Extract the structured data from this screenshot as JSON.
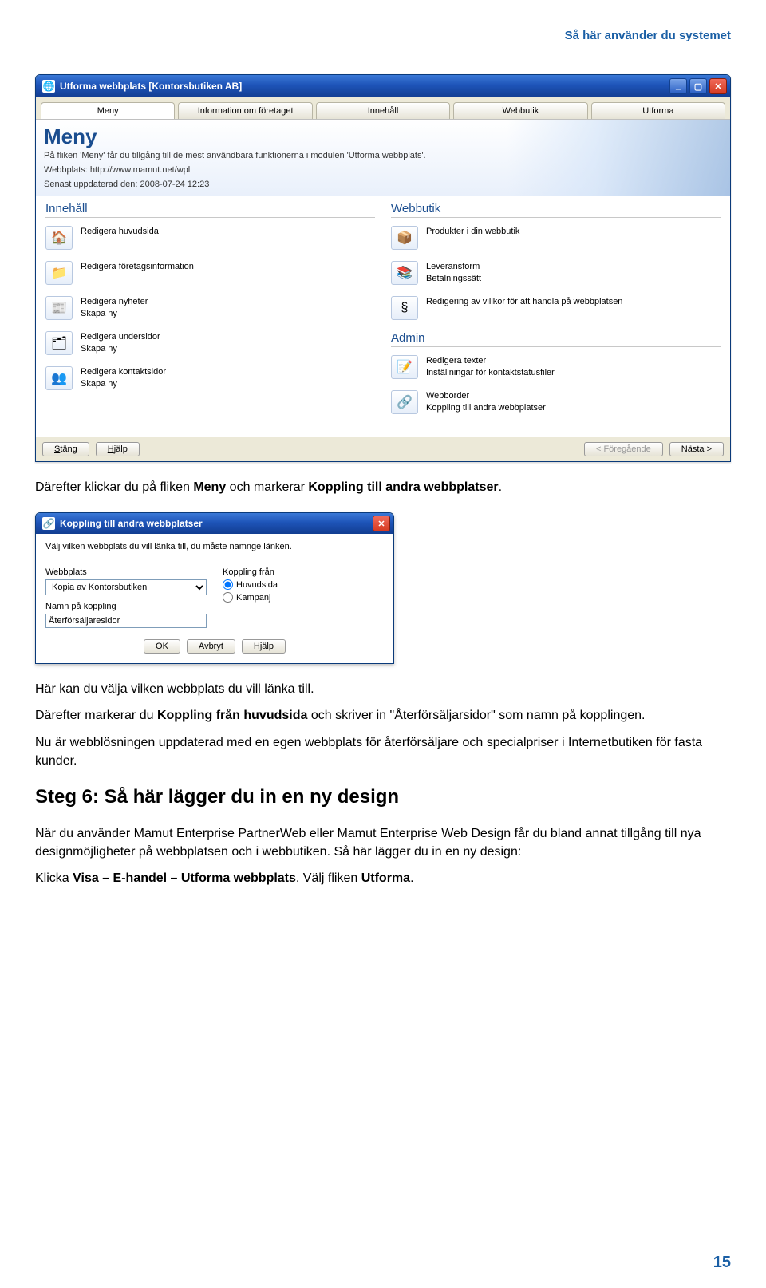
{
  "headerRight": "Så här använder du systemet",
  "pageNumber": "15",
  "window1": {
    "title": "Utforma webbplats [Kontorsbutiken AB]",
    "tabs": [
      "Meny",
      "Information om företaget",
      "Innehåll",
      "Webbutik",
      "Utforma"
    ],
    "activeTab": 0,
    "pageTitle": "Meny",
    "pageSub": "På fliken 'Meny' får du tillgång till de mest användbara funktionerna i modulen 'Utforma webbplats'.",
    "metaUrlLabel": "Webbplats: http://www.mamut.net/wpl",
    "metaUpdatedLabel": "Senast uppdaterad den: 2008-07-24 12:23",
    "colInnehall": {
      "title": "Innehåll",
      "items": [
        {
          "icon": "🏠",
          "lines": [
            "Redigera huvudsida"
          ]
        },
        {
          "icon": "📁",
          "lines": [
            "Redigera företagsinformation"
          ]
        },
        {
          "icon": "📰",
          "lines": [
            "Redigera nyheter",
            "Skapa ny"
          ]
        },
        {
          "icon": "🗂",
          "lines": [
            "Redigera undersidor",
            "Skapa ny"
          ]
        },
        {
          "icon": "👥",
          "lines": [
            "Redigera kontaktsidor",
            "Skapa ny"
          ]
        }
      ]
    },
    "colWebbutik": {
      "title": "Webbutik",
      "items": [
        {
          "icon": "📦",
          "lines": [
            "Produkter i din webbutik"
          ]
        },
        {
          "icon": "📚",
          "lines": [
            "Leveransform",
            "Betalningssätt"
          ]
        },
        {
          "icon": "§",
          "lines": [
            "Redigering av villkor för att handla på webbplatsen"
          ]
        }
      ]
    },
    "colAdmin": {
      "title": "Admin",
      "items": [
        {
          "icon": "📝",
          "lines": [
            "Redigera texter",
            "Inställningar för kontaktstatusfiler"
          ]
        },
        {
          "icon": "🔗",
          "lines": [
            "Webborder",
            "Koppling till andra webbplatser"
          ]
        }
      ]
    },
    "footerButtons": {
      "close": "Stäng",
      "help": "Hjälp",
      "prev": "< Föregående",
      "next": "Nästa >"
    }
  },
  "para1_pre": "Därefter klickar du på fliken ",
  "para1_b1": "Meny",
  "para1_mid": " och markerar ",
  "para1_b2": "Koppling till andra webbplatser",
  "para1_post": ".",
  "dialog": {
    "title": "Koppling till andra webbplatser",
    "instruction": "Välj vilken webbplats du vill länka till, du måste namnge länken.",
    "webbplatsLabel": "Webbplats",
    "webbplatsValue": "Kopia av Kontorsbutiken",
    "namnLabel": "Namn på koppling",
    "namnValue": "Återförsäljaresidor",
    "kopplingLabel": "Koppling från",
    "radio1": "Huvudsida",
    "radio2": "Kampanj",
    "buttons": {
      "ok": "OK",
      "cancel": "Avbryt",
      "help": "Hjälp"
    }
  },
  "para2": "Här kan du välja vilken webbplats du vill länka till.",
  "para3_pre": "Därefter markerar du ",
  "para3_b1": "Koppling från huvudsida",
  "para3_mid": " och skriver in \"Återförsäljarsidor\" som namn på kopplingen.",
  "para4": "Nu är webblösningen uppdaterad med en egen webbplats för återförsäljare och specialpriser i Internetbutiken för fasta kunder.",
  "stepHead": "Steg 6: Så här lägger du in en ny design",
  "para5": "När du använder Mamut Enterprise PartnerWeb eller Mamut Enterprise Web Design får du bland annat tillgång till nya designmöjligheter på webbplatsen och i webbutiken. Så här lägger du in en ny design:",
  "para6_pre": "Klicka ",
  "para6_b1": "Visa – E-handel – Utforma webbplats",
  "para6_mid": ". Välj fliken ",
  "para6_b2": "Utforma",
  "para6_post": "."
}
